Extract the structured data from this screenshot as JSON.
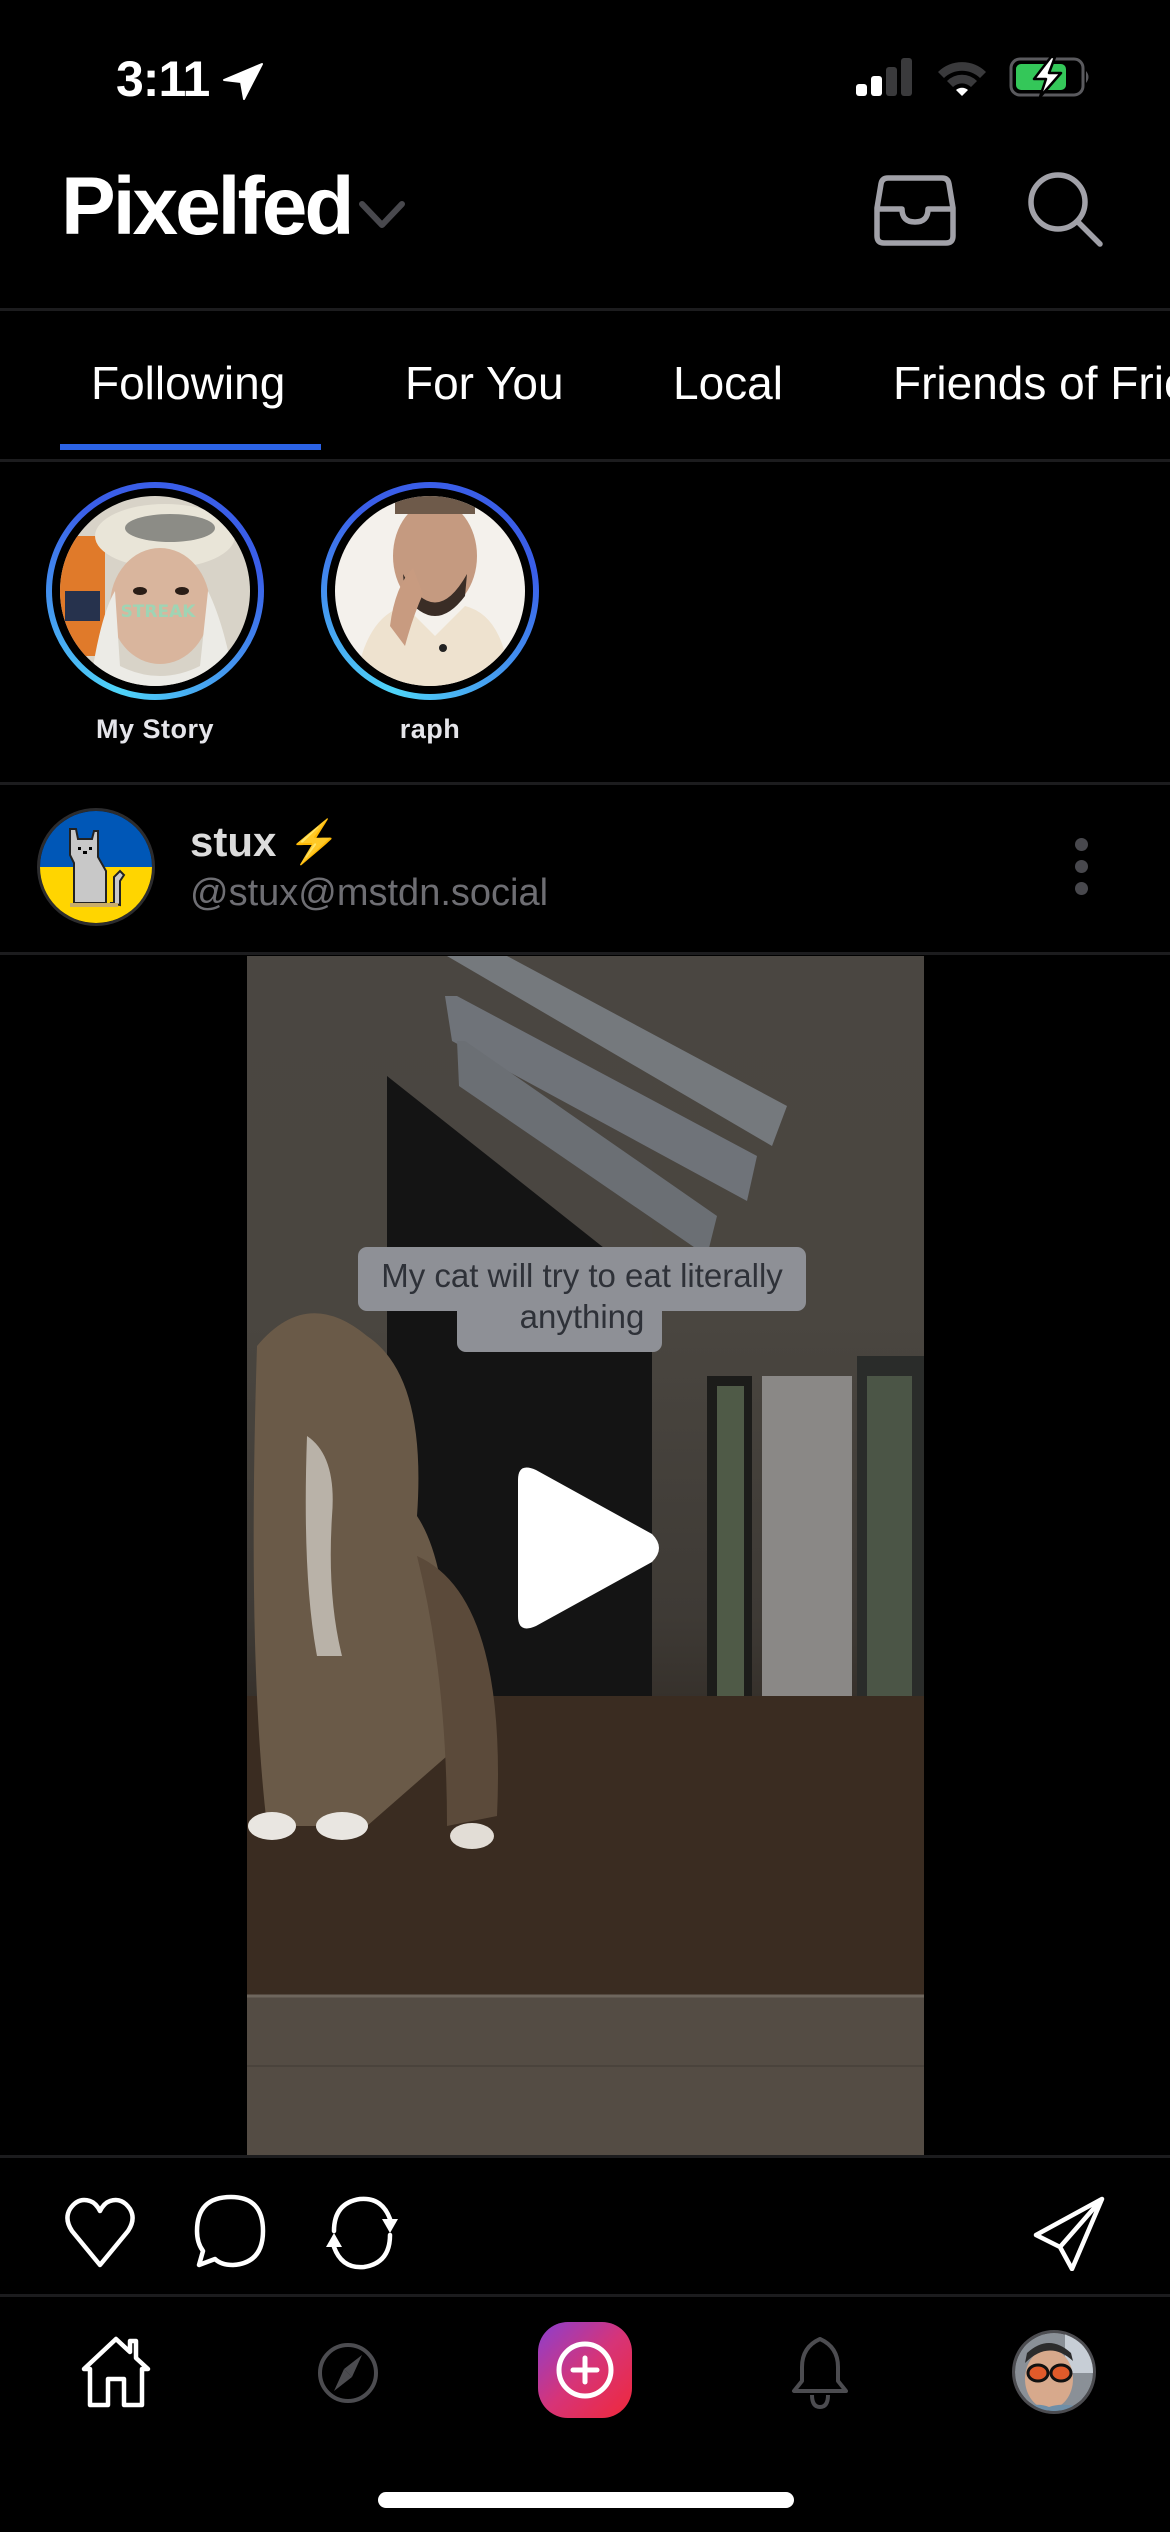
{
  "status_bar": {
    "time": "3:11",
    "location_active": true,
    "signal_bars_active": 2,
    "signal_bars_total": 4,
    "battery_level_percent": 70,
    "battery_charging": true,
    "battery_color": "#34c759"
  },
  "header": {
    "title": "Pixelfed",
    "title_menu_icon": "chevron-down-icon",
    "actions": [
      {
        "name": "inbox",
        "icon": "inbox-tray-icon"
      },
      {
        "name": "search",
        "icon": "search-icon"
      }
    ]
  },
  "feed_tabs": {
    "active_index": 0,
    "accent_color": "#2b63e6",
    "items": [
      {
        "label": "Following"
      },
      {
        "label": "For You"
      },
      {
        "label": "Local"
      },
      {
        "label": "Friends of Friends"
      }
    ]
  },
  "stories": [
    {
      "label": "My Story",
      "avatar_overlay_text": "STREAK"
    },
    {
      "label": "raph"
    }
  ],
  "post": {
    "author": {
      "display_name": "stux",
      "name_emoji": "⚡",
      "handle": "@stux@mstdn.social"
    },
    "media": {
      "type": "video",
      "caption_overlay": "My cat will try to eat literally anything",
      "state": "paused"
    },
    "actions": [
      {
        "name": "like",
        "icon": "heart-icon"
      },
      {
        "name": "comment",
        "icon": "comment-bubble-icon"
      },
      {
        "name": "reblog",
        "icon": "reblog-arrows-icon"
      },
      {
        "name": "share",
        "icon": "send-icon"
      }
    ]
  },
  "bottom_nav": {
    "items": [
      {
        "name": "home",
        "icon": "home-icon",
        "active": true
      },
      {
        "name": "explore",
        "icon": "compass-icon",
        "active": false
      },
      {
        "name": "create",
        "icon": "plus-circle-icon",
        "active": false
      },
      {
        "name": "notifications",
        "icon": "bell-icon",
        "active": false
      },
      {
        "name": "profile",
        "icon": "profile-avatar",
        "active": false
      }
    ],
    "create_gradient": [
      "#8a3fd0",
      "#d63478",
      "#f0283a"
    ]
  }
}
